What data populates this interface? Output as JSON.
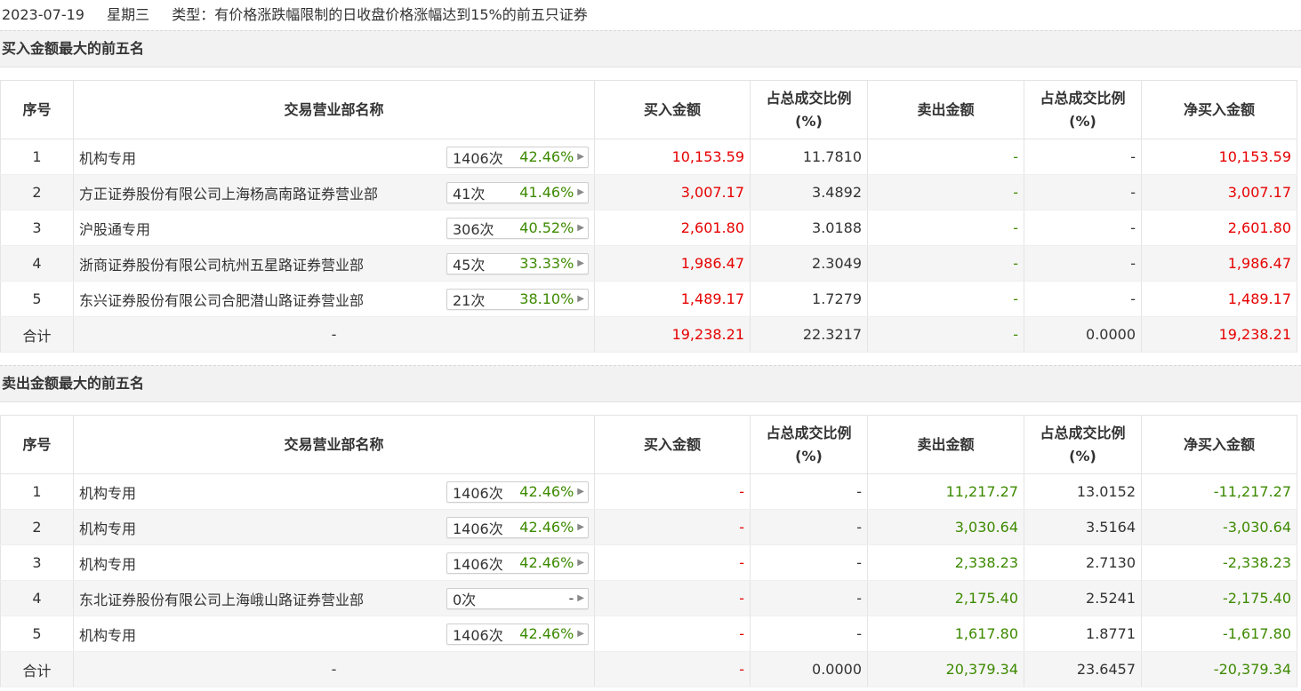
{
  "header": {
    "date": "2023-07-19",
    "weekday": "星期三",
    "type_text": "类型：有价格涨跌幅限制的日收盘价格涨幅达到15%的前五只证券"
  },
  "columns": {
    "seq": "序号",
    "name": "交易营业部名称",
    "buy": "买入金额",
    "buy_ratio_line1": "占总成交比例",
    "buy_ratio_line2": "(%)",
    "sell": "卖出金额",
    "sell_ratio_line1": "占总成交比例",
    "sell_ratio_line2": "(%)",
    "net": "净买入金额"
  },
  "buy_section": {
    "title": "买入金额最大的前五名",
    "rows": [
      {
        "seq": "1",
        "name": "机构专用",
        "count": "1406次",
        "rate": "42.46%",
        "buy": "10,153.59",
        "buy_ratio": "11.7810",
        "sell": "-",
        "sell_ratio": "-",
        "net": "10,153.59"
      },
      {
        "seq": "2",
        "name": "方正证券股份有限公司上海杨高南路证券营业部",
        "count": "41次",
        "rate": "41.46%",
        "buy": "3,007.17",
        "buy_ratio": "3.4892",
        "sell": "-",
        "sell_ratio": "-",
        "net": "3,007.17"
      },
      {
        "seq": "3",
        "name": "沪股通专用",
        "count": "306次",
        "rate": "40.52%",
        "buy": "2,601.80",
        "buy_ratio": "3.0188",
        "sell": "-",
        "sell_ratio": "-",
        "net": "2,601.80"
      },
      {
        "seq": "4",
        "name": "浙商证券股份有限公司杭州五星路证券营业部",
        "count": "45次",
        "rate": "33.33%",
        "buy": "1,986.47",
        "buy_ratio": "2.3049",
        "sell": "-",
        "sell_ratio": "-",
        "net": "1,986.47"
      },
      {
        "seq": "5",
        "name": "东兴证券股份有限公司合肥潜山路证券营业部",
        "count": "21次",
        "rate": "38.10%",
        "buy": "1,489.17",
        "buy_ratio": "1.7279",
        "sell": "-",
        "sell_ratio": "-",
        "net": "1,489.17"
      }
    ],
    "total": {
      "label": "合计",
      "name": "-",
      "buy": "19,238.21",
      "buy_ratio": "22.3217",
      "sell": "-",
      "sell_ratio": "0.0000",
      "net": "19,238.21"
    }
  },
  "sell_section": {
    "title": "卖出金额最大的前五名",
    "rows": [
      {
        "seq": "1",
        "name": "机构专用",
        "count": "1406次",
        "rate": "42.46%",
        "buy": "-",
        "buy_ratio": "-",
        "sell": "11,217.27",
        "sell_ratio": "13.0152",
        "net": "-11,217.27"
      },
      {
        "seq": "2",
        "name": "机构专用",
        "count": "1406次",
        "rate": "42.46%",
        "buy": "-",
        "buy_ratio": "-",
        "sell": "3,030.64",
        "sell_ratio": "3.5164",
        "net": "-3,030.64"
      },
      {
        "seq": "3",
        "name": "机构专用",
        "count": "1406次",
        "rate": "42.46%",
        "buy": "-",
        "buy_ratio": "-",
        "sell": "2,338.23",
        "sell_ratio": "2.7130",
        "net": "-2,338.23"
      },
      {
        "seq": "4",
        "name": "东北证券股份有限公司上海峨山路证券营业部",
        "count": "0次",
        "rate": "-",
        "buy": "-",
        "buy_ratio": "-",
        "sell": "2,175.40",
        "sell_ratio": "2.5241",
        "net": "-2,175.40"
      },
      {
        "seq": "5",
        "name": "机构专用",
        "count": "1406次",
        "rate": "42.46%",
        "buy": "-",
        "buy_ratio": "-",
        "sell": "1,617.80",
        "sell_ratio": "1.8771",
        "net": "-1,617.80"
      }
    ],
    "total": {
      "label": "合计",
      "name": "-",
      "buy": "-",
      "buy_ratio": "0.0000",
      "sell": "20,379.34",
      "sell_ratio": "23.6457",
      "net": "-20,379.34"
    }
  },
  "colors": {
    "up": "#e60000",
    "down": "#3d8a00",
    "header_bg": "#f2f2f2",
    "alt_row": "#f5f5f5"
  }
}
